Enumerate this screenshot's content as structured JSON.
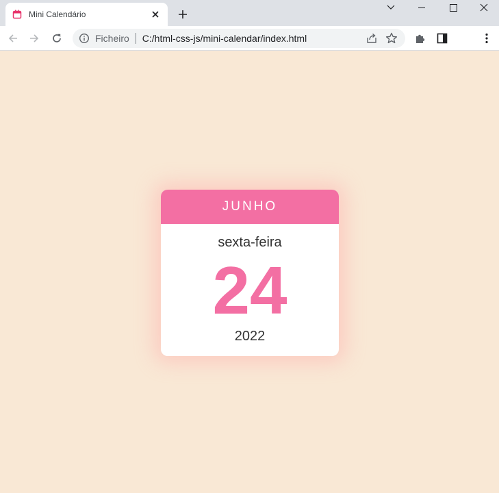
{
  "browser": {
    "tab": {
      "title": "Mini Calendário",
      "favicon": "calendar-icon",
      "favicon_color": "#e8336b"
    },
    "window_controls": [
      "chevron-down-icon",
      "minimize-icon",
      "maximize-icon",
      "close-icon"
    ],
    "address_bar": {
      "security_label": "Ficheiro",
      "url": "C:/html-css-js/mini-calendar/index.html"
    },
    "toolbar_icons": [
      "back-icon",
      "forward-icon",
      "reload-icon",
      "info-icon",
      "share-icon",
      "star-icon",
      "puzzle-icon",
      "side-panel-icon",
      "more-icon"
    ]
  },
  "page": {
    "background_color": "#f9e8d5",
    "accent_color": "#f36fa3",
    "calendar": {
      "month": "JUNHO",
      "weekday": "sexta-feira",
      "day": "24",
      "year": "2022"
    }
  }
}
